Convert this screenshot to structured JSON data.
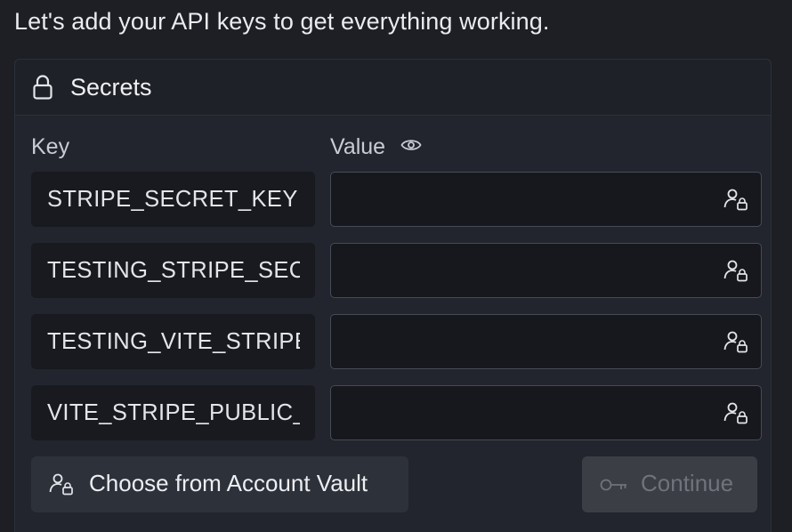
{
  "intro_text": "Let's add your API keys to get everything working.",
  "secrets_card": {
    "title": "Secrets",
    "title_icon": "lock-icon",
    "columns": {
      "key_label": "Key",
      "value_label": "Value",
      "value_icon": "eye-icon"
    },
    "rows": [
      {
        "key": "STRIPE_SECRET_KEY",
        "value": "",
        "vault_icon": "user-lock-icon"
      },
      {
        "key": "TESTING_STRIPE_SECRET_KEY",
        "value": "",
        "vault_icon": "user-lock-icon"
      },
      {
        "key": "TESTING_VITE_STRIPE_PUBLIC_KEY",
        "value": "",
        "vault_icon": "user-lock-icon"
      },
      {
        "key": "VITE_STRIPE_PUBLIC_KEY",
        "value": "",
        "vault_icon": "user-lock-icon"
      }
    ],
    "vault_button_label": "Choose from Account Vault",
    "continue_button_label": "Continue",
    "continue_disabled": true
  },
  "colors": {
    "page_bg": "#1d1f25",
    "card_bg": "#22252d",
    "key_field_bg": "#181a20",
    "value_field_border": "#474b55",
    "disabled_button_bg": "#3b3e45",
    "disabled_text": "#6f737b"
  }
}
